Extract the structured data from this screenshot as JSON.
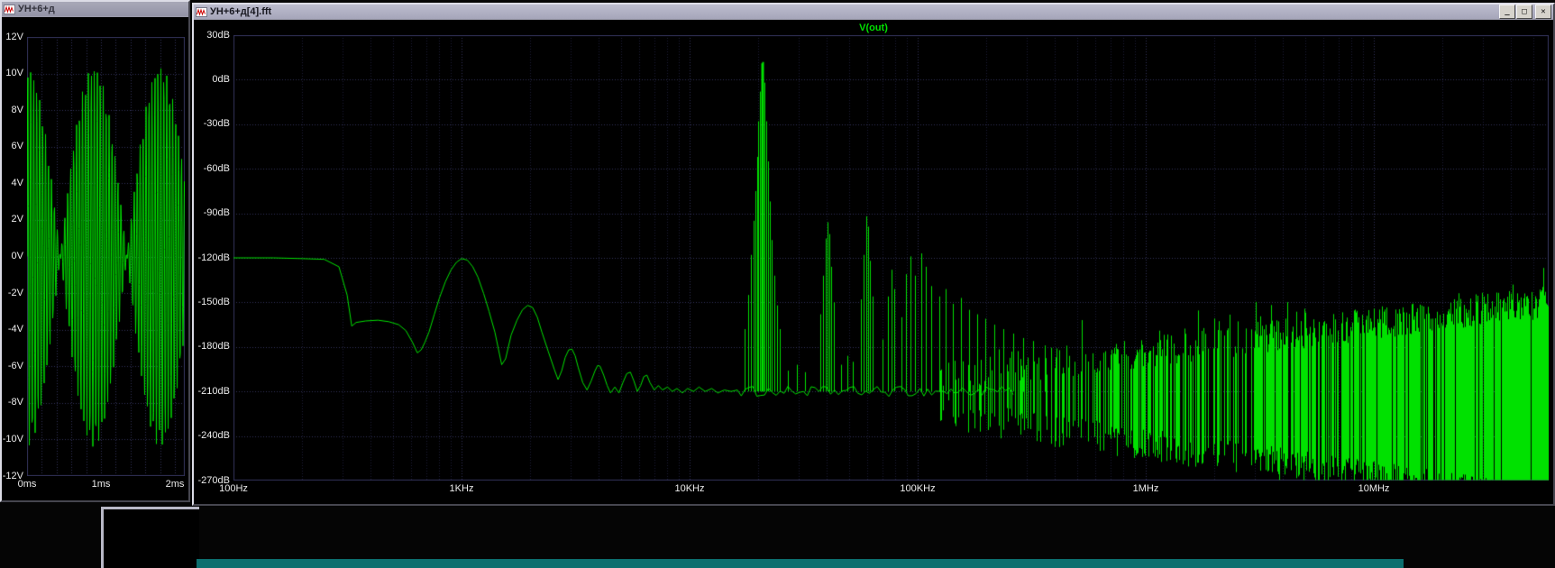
{
  "left_window": {
    "title": "УН+6+д",
    "icon": "waveform-icon"
  },
  "right_window": {
    "title": "УН+6+д[4].fft",
    "icon": "waveform-icon",
    "buttons": {
      "minimize": "_",
      "maximize": "□",
      "close": "✕"
    }
  },
  "colors": {
    "trace": "#00e100",
    "grid": "#32325a",
    "plot_bg": "#000000",
    "axis_text": "#ececec",
    "teal_strip": "#0c6f6f"
  },
  "chart_data": [
    {
      "name": "time-domain",
      "type": "line",
      "title": "",
      "xtick_labels": [
        "0ms",
        "1ms",
        "2ms"
      ],
      "xlim_ms": [
        0,
        2.2
      ],
      "ytick_labels": [
        "12V",
        "10V",
        "8V",
        "6V",
        "4V",
        "2V",
        "0V",
        "-2V",
        "-4V",
        "-6V",
        "-8V",
        "-10V",
        "-12V"
      ],
      "ylim_v": [
        -12,
        12
      ],
      "grid": "dotted",
      "series": [
        {
          "color": "#00e100",
          "model": "am_beat",
          "carrier_cycles_per_ms": 25,
          "envelope_peak_v": 10.4,
          "envelope_lobe_ms": 0.9,
          "envelope_zero_ms": [
            0.45,
            1.35
          ],
          "envelope_peaks_ms": [
            0,
            0.9,
            1.8
          ]
        }
      ]
    },
    {
      "name": "fft",
      "type": "line",
      "title": "V(out)",
      "xscale": "log",
      "xticks_hz": [
        100,
        1000,
        10000,
        100000,
        1000000,
        10000000
      ],
      "xtick_labels": [
        "100Hz",
        "1KHz",
        "10KHz",
        "100KHz",
        "1MHz",
        "10MHz"
      ],
      "xlim_hz": [
        100,
        60000000
      ],
      "ytick_labels": [
        "30dB",
        "0dB",
        "-30dB",
        "-60dB",
        "-90dB",
        "-120dB",
        "-150dB",
        "-180dB",
        "-210dB",
        "-240dB",
        "-270dB"
      ],
      "ylim_db": [
        -270,
        30
      ],
      "grid": "dotted",
      "baseline_points_hz_db": [
        [
          100,
          -120
        ],
        [
          150,
          -120
        ],
        [
          200,
          -120.5
        ],
        [
          250,
          -121
        ],
        [
          290,
          -126
        ],
        [
          315,
          -145
        ],
        [
          330,
          -166
        ],
        [
          345,
          -163.5
        ],
        [
          380,
          -162.5
        ],
        [
          430,
          -162
        ],
        [
          480,
          -163
        ],
        [
          530,
          -165
        ],
        [
          570,
          -169
        ],
        [
          610,
          -177
        ],
        [
          640,
          -184
        ],
        [
          665,
          -182
        ],
        [
          690,
          -177
        ],
        [
          720,
          -170
        ],
        [
          760,
          -158
        ],
        [
          800,
          -147
        ],
        [
          850,
          -136
        ],
        [
          900,
          -128
        ],
        [
          950,
          -123
        ],
        [
          1000,
          -120.5
        ],
        [
          1060,
          -121.5
        ],
        [
          1120,
          -126
        ],
        [
          1180,
          -133
        ],
        [
          1250,
          -144
        ],
        [
          1320,
          -156
        ],
        [
          1400,
          -170
        ],
        [
          1500,
          -192
        ],
        [
          1560,
          -188
        ],
        [
          1650,
          -172
        ],
        [
          1750,
          -162
        ],
        [
          1850,
          -155
        ],
        [
          1950,
          -152
        ],
        [
          2050,
          -153.5
        ],
        [
          2150,
          -160
        ],
        [
          2250,
          -170
        ],
        [
          2400,
          -183
        ],
        [
          2550,
          -195
        ],
        [
          2650,
          -202
        ],
        [
          2750,
          -196
        ],
        [
          2850,
          -187
        ],
        [
          2950,
          -182
        ],
        [
          3050,
          -181.5
        ],
        [
          3150,
          -186
        ],
        [
          3250,
          -194
        ],
        [
          3400,
          -204
        ],
        [
          3550,
          -209
        ],
        [
          3700,
          -203
        ],
        [
          3850,
          -196
        ],
        [
          3950,
          -192.5
        ],
        [
          4050,
          -193
        ],
        [
          4200,
          -199
        ],
        [
          4350,
          -206
        ],
        [
          4500,
          -211
        ],
        [
          4700,
          -207
        ],
        [
          4900,
          -211
        ],
        [
          5100,
          -204
        ],
        [
          5300,
          -198
        ],
        [
          5500,
          -197
        ],
        [
          5700,
          -203
        ],
        [
          5900,
          -210
        ],
        [
          6100,
          -206
        ],
        [
          6300,
          -200
        ],
        [
          6500,
          -199
        ],
        [
          6700,
          -204
        ],
        [
          7000,
          -209
        ],
        [
          7300,
          -206
        ],
        [
          7600,
          -209
        ],
        [
          8000,
          -207
        ],
        [
          8400,
          -210
        ],
        [
          8800,
          -208
        ],
        [
          9300,
          -211
        ],
        [
          9800,
          -208
        ],
        [
          10400,
          -210
        ],
        [
          11000,
          -207
        ],
        [
          11700,
          -210
        ],
        [
          12500,
          -208
        ],
        [
          13300,
          -211
        ],
        [
          14200,
          -209
        ],
        [
          15200,
          -210
        ],
        [
          16200,
          -209
        ]
      ],
      "harmonic_spikes_hz_db": [
        [
          17400,
          -168
        ],
        [
          18000,
          -145
        ],
        [
          18500,
          -118
        ],
        [
          19000,
          -95
        ],
        [
          19400,
          -75
        ],
        [
          19750,
          -52
        ],
        [
          20050,
          -28
        ],
        [
          20350,
          -8
        ],
        [
          20650,
          11
        ],
        [
          20950,
          12
        ],
        [
          21250,
          -2
        ],
        [
          21600,
          -28
        ],
        [
          22000,
          -55
        ],
        [
          22450,
          -82
        ],
        [
          22950,
          -108
        ],
        [
          23500,
          -132
        ],
        [
          24100,
          -152
        ],
        [
          24800,
          -168
        ],
        [
          27000,
          -196
        ],
        [
          29500,
          -192
        ],
        [
          32000,
          -197
        ],
        [
          37500,
          -158
        ],
        [
          38500,
          -132
        ],
        [
          39400,
          -107
        ],
        [
          40200,
          -96
        ],
        [
          41000,
          -104
        ],
        [
          41900,
          -126
        ],
        [
          42900,
          -150
        ],
        [
          46000,
          -192
        ],
        [
          49000,
          -186
        ],
        [
          52000,
          -190
        ],
        [
          56500,
          -148
        ],
        [
          58000,
          -118
        ],
        [
          59400,
          -92
        ],
        [
          60500,
          -99
        ],
        [
          61800,
          -122
        ],
        [
          63300,
          -146
        ],
        [
          70000,
          -175
        ],
        [
          74000,
          -146
        ],
        [
          76500,
          -128
        ],
        [
          79000,
          -141
        ],
        [
          85000,
          -160
        ],
        [
          89000,
          -131
        ],
        [
          93000,
          -119
        ],
        [
          97500,
          -132
        ],
        [
          104000,
          -117
        ],
        [
          109000,
          -126
        ],
        [
          115000,
          -139
        ],
        [
          124000,
          -146
        ],
        [
          133000,
          -141
        ],
        [
          143000,
          -151
        ],
        [
          155000,
          -147
        ],
        [
          168000,
          -155
        ],
        [
          182000,
          -158
        ],
        [
          198000,
          -161
        ],
        [
          216000,
          -165
        ],
        [
          237000,
          -168
        ],
        [
          262000,
          -171
        ],
        [
          290000,
          -174
        ],
        [
          322000,
          -176
        ],
        [
          360000,
          -179
        ],
        [
          405000,
          -181
        ]
      ],
      "noise": {
        "grass_start_hz": 120000,
        "floor_db": -210,
        "top_start_db": -200,
        "top_end_db": -150,
        "bottom_start_db": -225,
        "bottom_end_db": -285,
        "density_min": 0.3,
        "density_max": 1,
        "jitter_db": 22
      }
    }
  ]
}
